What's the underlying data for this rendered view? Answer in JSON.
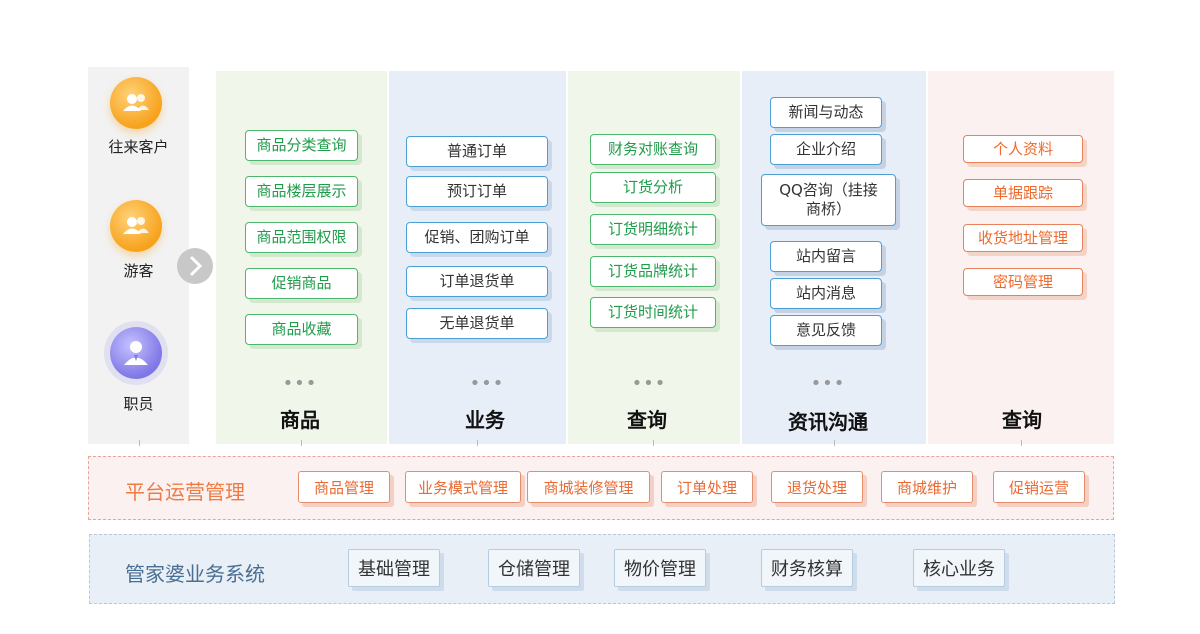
{
  "users": [
    {
      "label": "往来客户",
      "icon": "client-group-icon",
      "color": "#f7a21c"
    },
    {
      "label": "游客",
      "icon": "visitor-group-icon",
      "color": "#f7a21c"
    },
    {
      "label": "职员",
      "icon": "staff-person-icon",
      "color": "#7f77e6"
    }
  ],
  "columns": [
    {
      "title": "商品",
      "color": "#1f9c4a",
      "items": [
        "商品分类查询",
        "商品楼层展示",
        "商品范围权限",
        "促销商品",
        "商品收藏"
      ],
      "more": "•••"
    },
    {
      "title": "业务",
      "items": [
        "普通订单",
        "预订订单",
        "促销、团购订单",
        "订单退货单",
        "无单退货单"
      ],
      "more": "•••"
    },
    {
      "title": "查询",
      "color": "#1f9c4a",
      "items": [
        "财务对账查询",
        "订货分析",
        "订货明细统计",
        "订货品牌统计",
        "订货时间统计"
      ],
      "more": "•••"
    },
    {
      "title": "资讯沟通",
      "items": [
        "新闻与动态",
        "企业介绍",
        "QQ咨询（挂接商桥）",
        "站内留言",
        "站内消息",
        "意见反馈"
      ],
      "more": "•••"
    },
    {
      "title": "查询",
      "color": "#ee6a2c",
      "items": [
        "个人资料",
        "单据跟踪",
        "收货地址管理",
        "密码管理"
      ]
    }
  ],
  "platform": {
    "title": "平台运营管理",
    "modules": [
      "商品管理",
      "业务模式管理",
      "商城装修管理",
      "订单处理",
      "退货处理",
      "商城维护",
      "促销运营"
    ]
  },
  "erp": {
    "title": "管家婆业务系统",
    "modules": [
      "基础管理",
      "仓储管理",
      "物价管理",
      "财务核算",
      "核心业务"
    ]
  }
}
